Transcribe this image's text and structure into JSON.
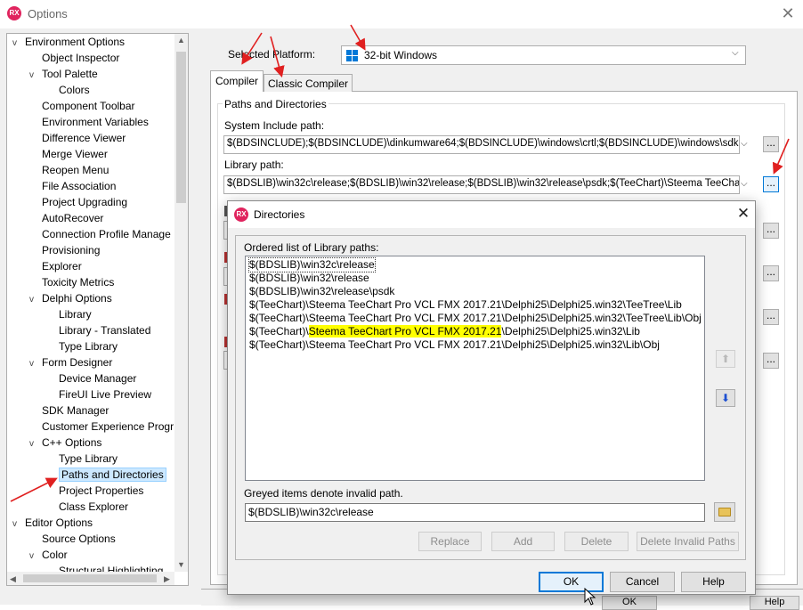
{
  "window": {
    "icon": "RX",
    "title": "Options",
    "close_glyph": "✕"
  },
  "tree": {
    "items": [
      {
        "label": "Environment Options",
        "toggle": "v"
      },
      {
        "label": "Object Inspector",
        "toggle": ""
      },
      {
        "label": "Tool Palette",
        "toggle": "v"
      },
      {
        "label": "Colors",
        "toggle": ""
      },
      {
        "label": "Component Toolbar",
        "toggle": ""
      },
      {
        "label": "Environment Variables",
        "toggle": ""
      },
      {
        "label": "Difference Viewer",
        "toggle": ""
      },
      {
        "label": "Merge Viewer",
        "toggle": ""
      },
      {
        "label": "Reopen Menu",
        "toggle": ""
      },
      {
        "label": "File Association",
        "toggle": ""
      },
      {
        "label": "Project Upgrading",
        "toggle": ""
      },
      {
        "label": "AutoRecover",
        "toggle": ""
      },
      {
        "label": "Connection Profile Manage",
        "toggle": ""
      },
      {
        "label": "Provisioning",
        "toggle": ""
      },
      {
        "label": "Explorer",
        "toggle": ""
      },
      {
        "label": "Toxicity Metrics",
        "toggle": ""
      },
      {
        "label": "Delphi Options",
        "toggle": "v"
      },
      {
        "label": "Library",
        "toggle": ""
      },
      {
        "label": "Library - Translated",
        "toggle": ""
      },
      {
        "label": "Type Library",
        "toggle": ""
      },
      {
        "label": "Form Designer",
        "toggle": "v"
      },
      {
        "label": "Device Manager",
        "toggle": ""
      },
      {
        "label": "FireUI Live Preview",
        "toggle": ""
      },
      {
        "label": "SDK Manager",
        "toggle": ""
      },
      {
        "label": "Customer Experience Progr",
        "toggle": ""
      },
      {
        "label": "C++ Options",
        "toggle": "v"
      },
      {
        "label": "Type Library",
        "toggle": ""
      },
      {
        "label": "Paths and Directories",
        "toggle": ""
      },
      {
        "label": "Project Properties",
        "toggle": ""
      },
      {
        "label": "Class Explorer",
        "toggle": ""
      },
      {
        "label": "Editor Options",
        "toggle": "v"
      },
      {
        "label": "Source Options",
        "toggle": ""
      },
      {
        "label": "Color",
        "toggle": "v"
      },
      {
        "label": "Structural Highlighting",
        "toggle": ""
      }
    ]
  },
  "platform": {
    "label": "Selected Platform:",
    "value": "32-bit Windows"
  },
  "tabs": {
    "compiler": "Compiler",
    "classic": "Classic Compiler"
  },
  "paths_group": {
    "title": "Paths and Directories",
    "system_include_label": "System Include path:",
    "system_include_value": "$(BDSINCLUDE);$(BDSINCLUDE)\\dinkumware64;$(BDSINCLUDE)\\windows\\crtl;$(BDSINCLUDE)\\windows\\sdk",
    "library_label": "Library path:",
    "library_value": "$(BDSLIB)\\win32c\\release;$(BDSLIB)\\win32\\release;$(BDSLIB)\\win32\\release\\psdk;$(TeeChart)\\Steema TeeCha",
    "ellipsis": "..."
  },
  "background_buttons": {
    "ok": "OK",
    "help": "Help"
  },
  "dialog": {
    "icon": "RX",
    "title": "Directories",
    "close_glyph": "✕",
    "ordered_label": "Ordered list of Library paths:",
    "list": [
      {
        "pre": "$(BDSLIB)\\win32c\\release",
        "hl": "",
        "post": ""
      },
      {
        "pre": "$(BDSLIB)\\win32\\release",
        "hl": "",
        "post": ""
      },
      {
        "pre": "$(BDSLIB)\\win32\\release\\psdk",
        "hl": "",
        "post": ""
      },
      {
        "pre": "$(TeeChart)\\Steema TeeChart Pro VCL FMX 2017.21\\Delphi25\\Delphi25.win32\\TeeTree\\Lib",
        "hl": "",
        "post": ""
      },
      {
        "pre": "$(TeeChart)\\Steema TeeChart Pro VCL FMX 2017.21\\Delphi25\\Delphi25.win32\\TeeTree\\Lib\\Obj",
        "hl": "",
        "post": ""
      },
      {
        "pre": "$(TeeChart)\\",
        "hl": "Steema TeeChart Pro VCL FMX 2017.21",
        "post": "\\Delphi25\\Delphi25.win32\\Lib"
      },
      {
        "pre": "$(TeeChart)\\Steema TeeChart Pro VCL FMX 2017.21\\Delphi25\\Delphi25.win32\\Lib\\Obj",
        "hl": "",
        "post": ""
      }
    ],
    "move_up_glyph": "⬆",
    "move_down_glyph": "⬇",
    "greyed_note": "Greyed items denote invalid path.",
    "path_value": "$(BDSLIB)\\win32c\\release",
    "buttons": {
      "replace": "Replace",
      "add": "Add",
      "delete": "Delete",
      "delete_invalid": "Delete Invalid Paths",
      "ok": "OK",
      "cancel": "Cancel",
      "help": "Help"
    }
  },
  "colors": {
    "selection_bg": "#cce8ff",
    "highlight": "#ffff00",
    "annotation_arrow": "#e02020",
    "accent": "#0078d7"
  }
}
